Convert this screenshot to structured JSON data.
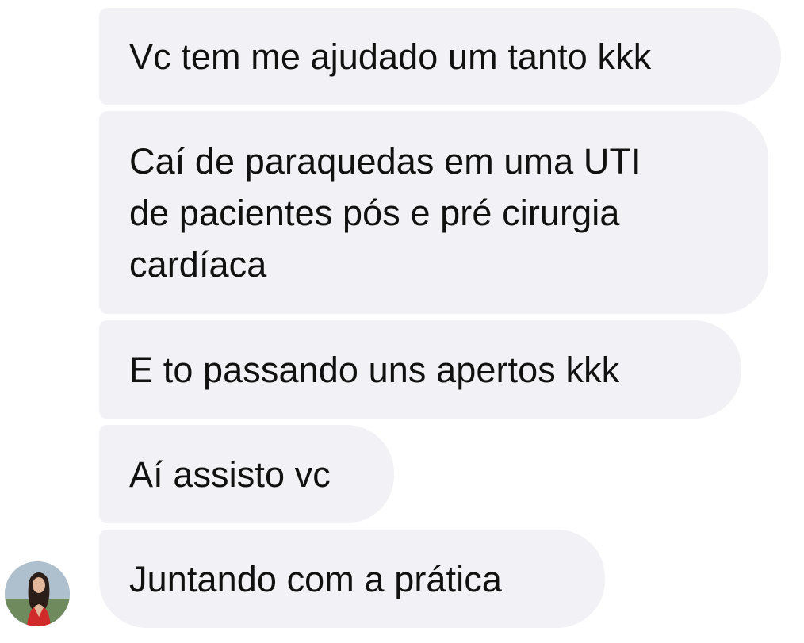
{
  "conversation": {
    "messages": [
      {
        "text": "Vc tem me ajudado um tanto kkk"
      },
      {
        "text": "Caí de paraquedas em uma UTI\nde pacientes pós e pré cirurgia\ncardíaca"
      },
      {
        "text": "E to passando uns apertos kkk"
      },
      {
        "text": "Aí assisto vc"
      },
      {
        "text": "Juntando com a prática"
      }
    ],
    "sender": {
      "avatar_icon": "profile-photo-icon"
    }
  },
  "colors": {
    "bubble_bg": "#f2f2f6",
    "text": "#111111",
    "background": "#ffffff"
  }
}
